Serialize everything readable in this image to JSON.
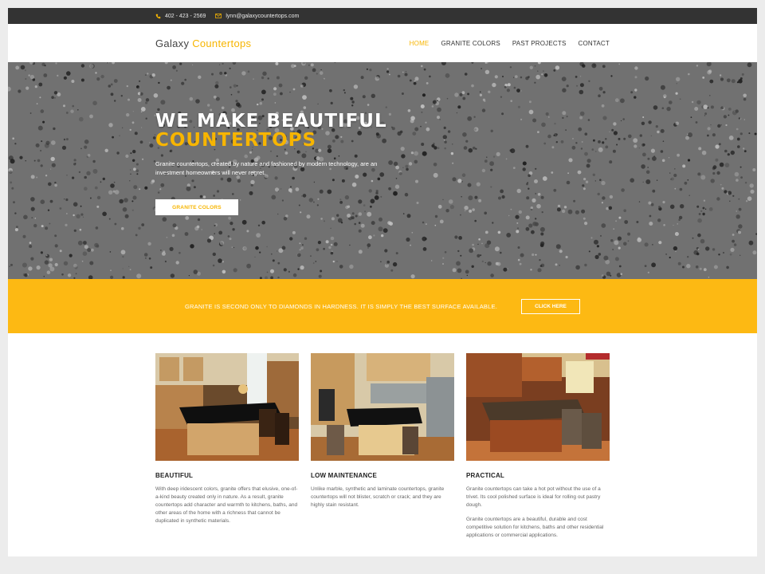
{
  "topbar": {
    "phone": "402 - 423 - 2569",
    "email": "lynn@galaxycountertops.com",
    "phone_icon": "phone-icon",
    "email_icon": "mail-icon"
  },
  "nav": {
    "logo_part1": "Galaxy",
    "logo_part2": "Countertops",
    "items": [
      {
        "label": "HOME"
      },
      {
        "label": "GRANITE COLORS"
      },
      {
        "label": "PAST PROJECTS"
      },
      {
        "label": "CONTACT"
      }
    ]
  },
  "hero": {
    "title_line1": "WE MAKE BEAUTIFUL",
    "title_line2": "COUNTERTOPS",
    "text": "Granite countertops, created by nature and fashioned by modern technology, are an investment homeowners will never regret.",
    "button_label": "GRANITE COLORS"
  },
  "band": {
    "message": "GRANITE IS SECOND ONLY TO DIAMONDS IN HARDNESS. IT IS SIMPLY THE BEST SURFACE AVAILABLE.",
    "button_label": "CLICK HERE"
  },
  "features": [
    {
      "title": "BEAUTIFUL",
      "paragraphs": [
        "With deep iridescent colors, granite offers that elusive, one-of-a-kind beauty created only in nature. As a result, granite countertops add character and warmth to kitchens, baths, and other areas of the home with a richness that cannot be duplicated in synthetic materials."
      ]
    },
    {
      "title": "LOW MAINTENANCE",
      "paragraphs": [
        "Unlike marble, synthetic and laminate countertops, granite countertops will not blister, scratch or crack; and they are highly stain resistant."
      ]
    },
    {
      "title": "PRACTICAL",
      "paragraphs": [
        "Granite countertops can take a hot pot without the use of a trivet. Its cool polished surface is ideal for rolling out pastry dough.",
        "Granite countertops are a beautiful, durable and cost competitive solution for kitchens, baths and other residential applications or commercial applications."
      ]
    }
  ],
  "colors": {
    "accent": "#f7b500",
    "band": "#fdb913",
    "topbar": "#333333"
  }
}
